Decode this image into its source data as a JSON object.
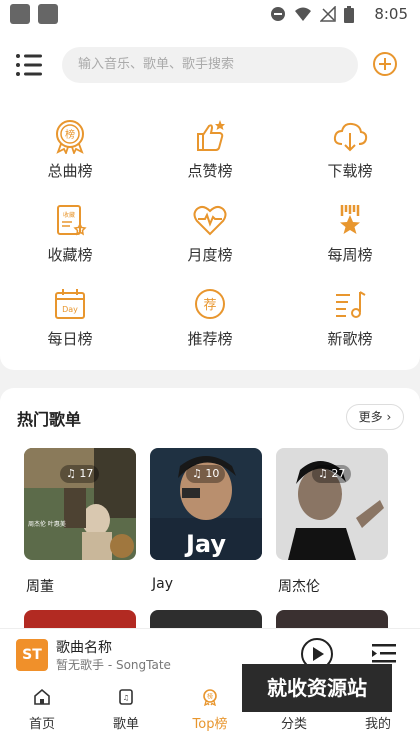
{
  "status_bar": {
    "time": "8:05"
  },
  "top_bar": {
    "search_placeholder": "输入音乐、歌单、歌手搜索"
  },
  "rankings": [
    {
      "label": "总曲榜",
      "icon": "medal-icon"
    },
    {
      "label": "点赞榜",
      "icon": "thumbs-up-icon"
    },
    {
      "label": "下载榜",
      "icon": "cloud-download-icon"
    },
    {
      "label": "收藏榜",
      "icon": "collection-icon"
    },
    {
      "label": "月度榜",
      "icon": "heart-pulse-icon"
    },
    {
      "label": "每周榜",
      "icon": "star-ribbon-icon"
    },
    {
      "label": "每日榜",
      "icon": "calendar-day-icon"
    },
    {
      "label": "推荐榜",
      "icon": "recommend-icon"
    },
    {
      "label": "新歌榜",
      "icon": "music-list-icon"
    }
  ],
  "hot_playlists": {
    "title": "热门歌单",
    "more_label": "更多",
    "items": [
      {
        "name": "周董",
        "plays": "17"
      },
      {
        "name": "Jay",
        "plays": "10"
      },
      {
        "name": "周杰伦",
        "plays": "27"
      }
    ]
  },
  "mini_player": {
    "thumb_text": "ST",
    "title": "歌曲名称",
    "subtitle": "暂无歌手 - SongTate"
  },
  "tabs": [
    {
      "label": "首页",
      "icon": "home-icon",
      "active": false
    },
    {
      "label": "歌单",
      "icon": "playlist-icon",
      "active": false
    },
    {
      "label": "Top榜",
      "icon": "top-chart-icon",
      "active": true
    },
    {
      "label": "分类",
      "icon": "category-icon",
      "active": false
    },
    {
      "label": "我的",
      "icon": "profile-icon",
      "active": false
    }
  ],
  "watermark": "就收资源站",
  "colors": {
    "accent": "#e8962e",
    "background": "#f2f2f2"
  }
}
